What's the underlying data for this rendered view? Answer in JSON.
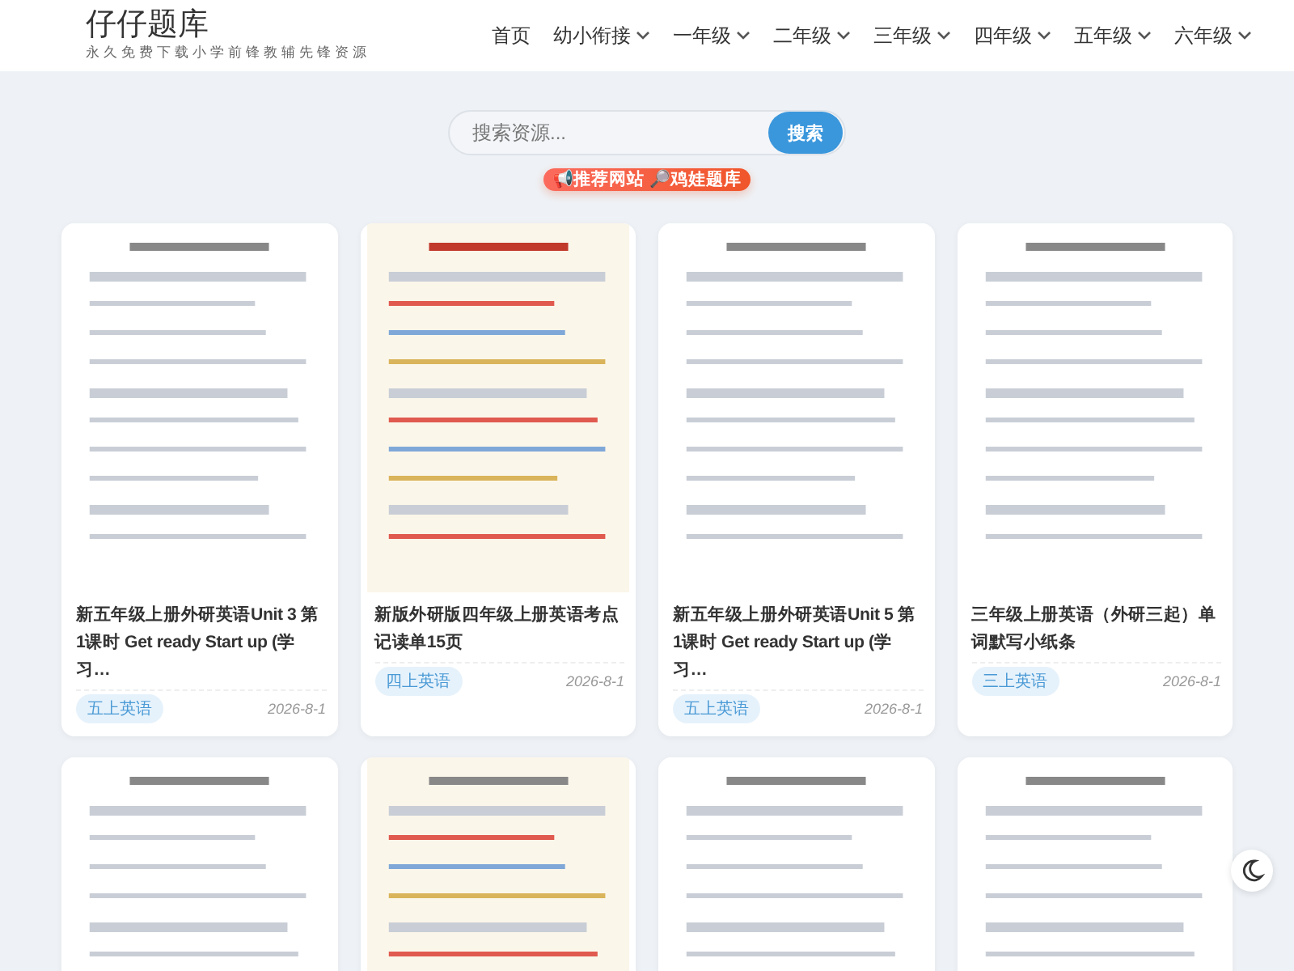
{
  "site": {
    "title": "仔仔题库",
    "tagline": "永久免费下载小学前锋教辅先锋资源"
  },
  "nav": [
    {
      "label": "首页",
      "dropdown": false
    },
    {
      "label": "幼小衔接",
      "dropdown": true
    },
    {
      "label": "一年级",
      "dropdown": true
    },
    {
      "label": "二年级",
      "dropdown": true
    },
    {
      "label": "三年级",
      "dropdown": true
    },
    {
      "label": "四年级",
      "dropdown": true
    },
    {
      "label": "五年级",
      "dropdown": true
    },
    {
      "label": "六年级",
      "dropdown": true
    }
  ],
  "search": {
    "placeholder": "搜索资源...",
    "button": "搜索"
  },
  "promo": "📢推荐网站 🔎鸡娃题库",
  "cards": [
    {
      "kind": "document",
      "title": "新五年级上册外研英语Unit 3 第1课时 Get ready Start up (学习…",
      "tag": "五上英语",
      "date": "2026-8-1"
    },
    {
      "kind": "document",
      "title": "新版外研版四年级上册英语考点记读单15页",
      "tag": "四上英语",
      "date": "2026-8-1"
    },
    {
      "kind": "document",
      "title": "新五年级上册外研英语Unit 5 第1课时 Get ready Start up (学习…",
      "tag": "五上英语",
      "date": "2026-8-1"
    },
    {
      "kind": "document",
      "title": "三年级上册英语（外研三起）单词默写小纸条",
      "tag": "三上英语",
      "date": "2026-8-1"
    },
    {
      "kind": "picture"
    },
    {
      "kind": "picture"
    },
    {
      "kind": "picture"
    },
    {
      "kind": "picture"
    }
  ]
}
